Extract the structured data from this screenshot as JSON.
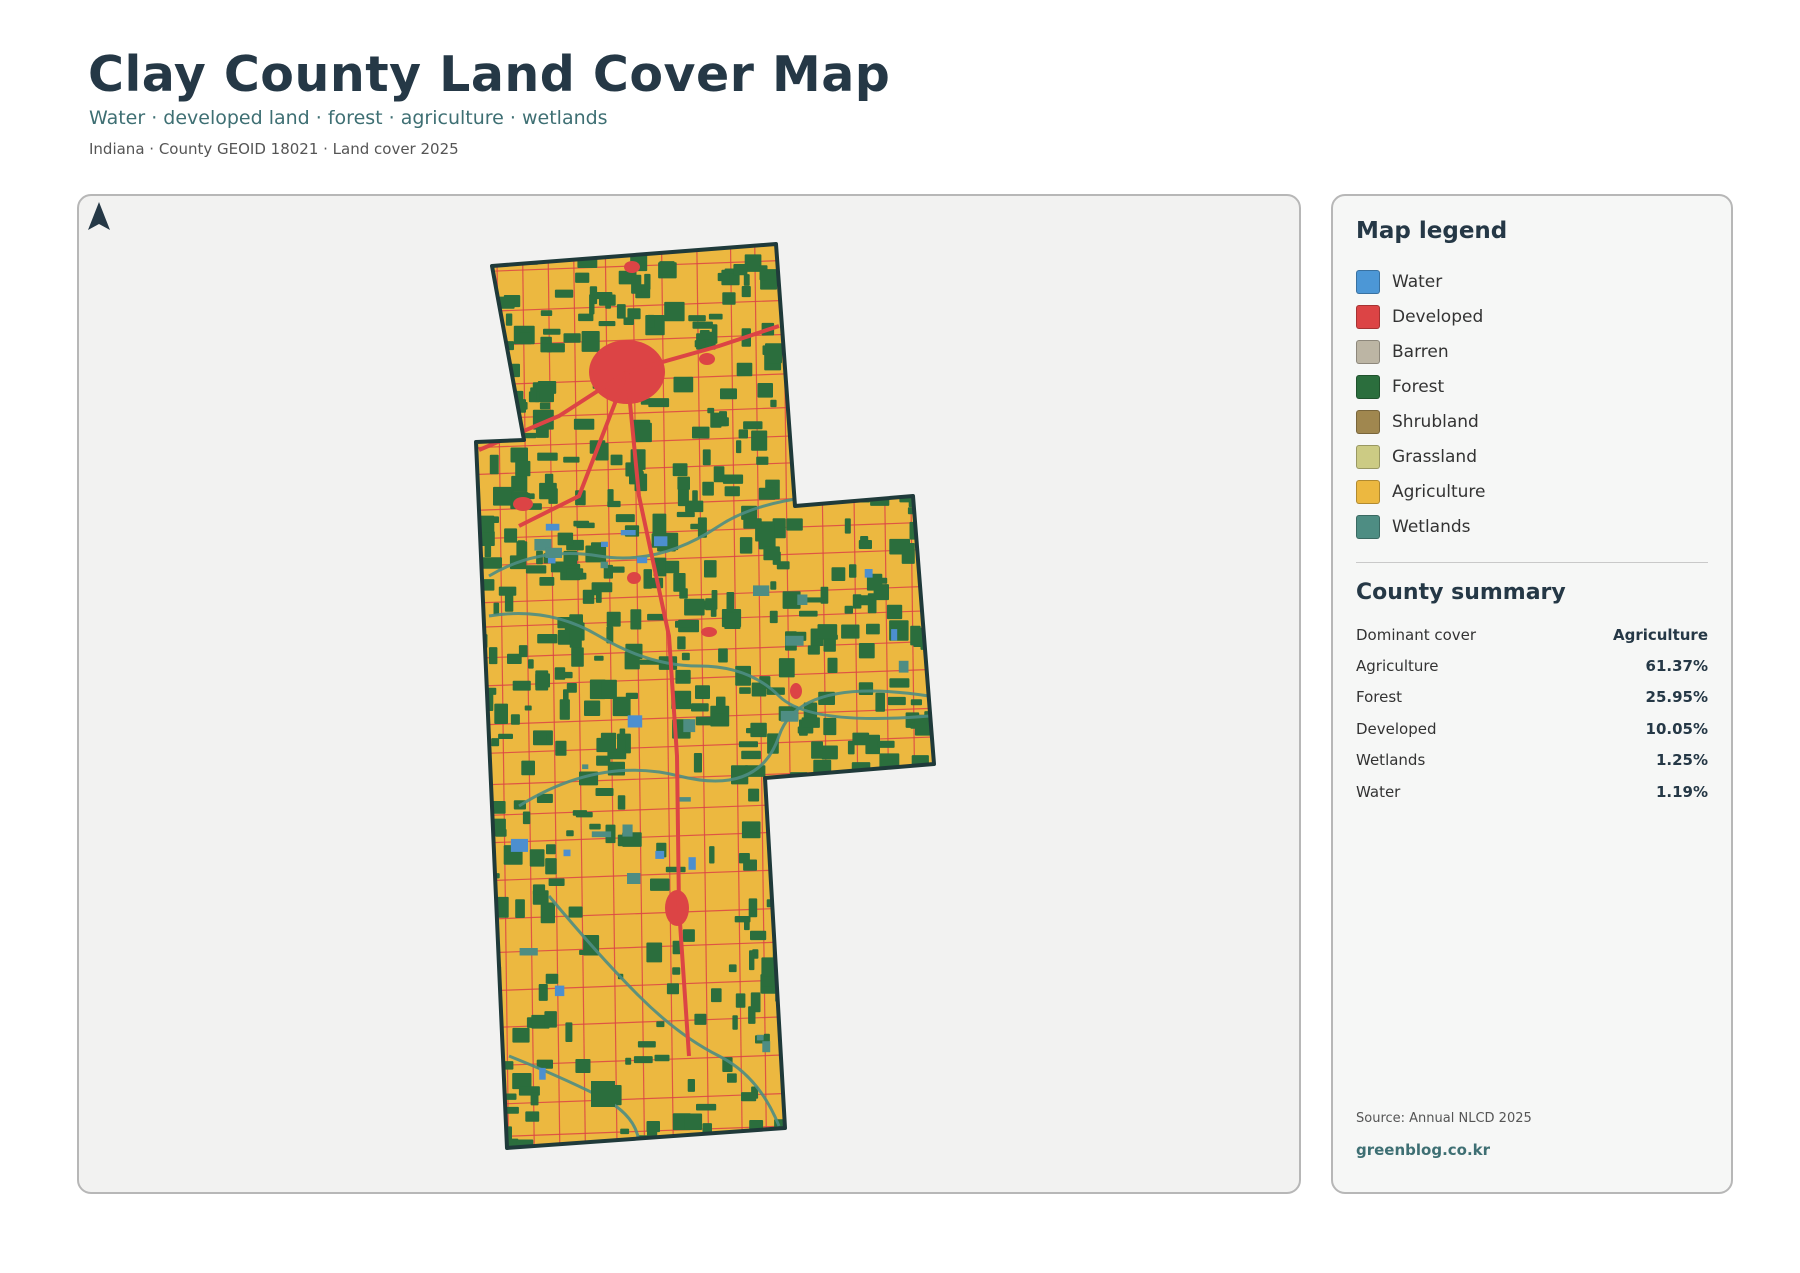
{
  "header": {
    "title": "Clay County Land Cover Map",
    "subtitle": "Water · developed land · forest · agriculture · wetlands",
    "meta": "Indiana · County GEOID 18021 · Land cover 2025"
  },
  "map": {
    "north_label": "N",
    "colors": {
      "panel_bg": "#f2f2f1",
      "agriculture": "#ecb840",
      "forest": "#2b6e3d",
      "developed": "#dc4445",
      "water": "#4c8fcf",
      "wetlands": "#4e8d83",
      "outline": "#1f3a3a"
    }
  },
  "legend": {
    "title": "Map legend",
    "items": [
      {
        "label": "Water",
        "color": "#4c97d6"
      },
      {
        "label": "Developed",
        "color": "#dc4445"
      },
      {
        "label": "Barren",
        "color": "#bcb5a4"
      },
      {
        "label": "Forest",
        "color": "#2b6e3d"
      },
      {
        "label": "Shrubland",
        "color": "#a0874f"
      },
      {
        "label": "Grassland",
        "color": "#cccb84"
      },
      {
        "label": "Agriculture",
        "color": "#ecb840"
      },
      {
        "label": "Wetlands",
        "color": "#4e8d83"
      }
    ]
  },
  "summary": {
    "title": "County summary",
    "rows": [
      {
        "key": "Dominant cover",
        "value": "Agriculture"
      },
      {
        "key": "Agriculture",
        "value": "61.37%"
      },
      {
        "key": "Forest",
        "value": "25.95%"
      },
      {
        "key": "Developed",
        "value": "10.05%"
      },
      {
        "key": "Wetlands",
        "value": "1.25%"
      },
      {
        "key": "Water",
        "value": "1.19%"
      }
    ]
  },
  "footer": {
    "source": "Source: Annual NLCD 2025",
    "brand": "greenblog.co.kr"
  }
}
